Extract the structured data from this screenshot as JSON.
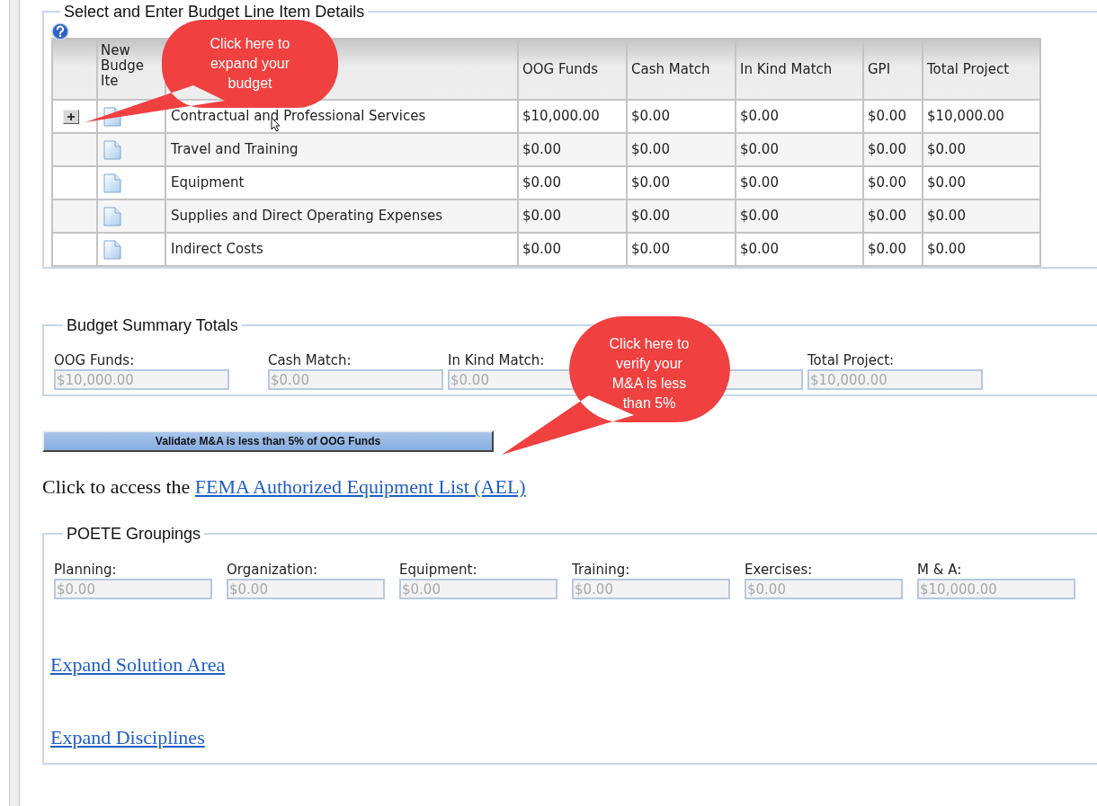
{
  "line_items": {
    "legend": "Select and Enter Budget Line Item Details",
    "new_item_header_lines": [
      "New",
      "Budge",
      "Ite"
    ],
    "columns": [
      "OOG Funds",
      "Cash Match",
      "In Kind Match",
      "GPI",
      "Total Project"
    ],
    "rows": [
      {
        "name": "Contractual and Professional Services",
        "expandable": true,
        "values": [
          "$10,000.00",
          "$0.00",
          "$0.00",
          "$0.00",
          "$10,000.00"
        ]
      },
      {
        "name": "Travel and Training",
        "expandable": false,
        "values": [
          "$0.00",
          "$0.00",
          "$0.00",
          "$0.00",
          "$0.00"
        ]
      },
      {
        "name": "Equipment",
        "expandable": false,
        "values": [
          "$0.00",
          "$0.00",
          "$0.00",
          "$0.00",
          "$0.00"
        ]
      },
      {
        "name": "Supplies and Direct Operating Expenses",
        "expandable": false,
        "values": [
          "$0.00",
          "$0.00",
          "$0.00",
          "$0.00",
          "$0.00"
        ]
      },
      {
        "name": "Indirect Costs",
        "expandable": false,
        "values": [
          "$0.00",
          "$0.00",
          "$0.00",
          "$0.00",
          "$0.00"
        ]
      }
    ]
  },
  "callouts": [
    {
      "text": "Click here to expand your budget"
    },
    {
      "text": "Click here to verify your M&A is less than 5%"
    }
  ],
  "summary": {
    "legend": "Budget Summary Totals",
    "fields": [
      {
        "label": "OOG Funds:",
        "value": "$10,000.00",
        "disabled": true
      },
      {
        "label": "Cash Match:",
        "value": "$0.00",
        "disabled": true
      },
      {
        "label": "In Kind Match:",
        "value": "$0.00",
        "disabled": true
      },
      {
        "disabled": true
      },
      {
        "label": "Total Project:",
        "value": "$10,000.00",
        "disabled": true
      }
    ]
  },
  "validate_button": "Validate M&A is less than 5% of OOG Funds",
  "access": {
    "text": "Click to access the",
    "link": "FEMA Authorized Equipment List (AEL)"
  },
  "poete": {
    "legend": "POETE Groupings",
    "fields": [
      {
        "label": "Planning:",
        "value": "$0.00",
        "disabled": true
      },
      {
        "label": "Organization:",
        "value": "$0.00",
        "disabled": true
      },
      {
        "label": "Equipment:",
        "value": "$0.00",
        "disabled": true
      },
      {
        "label": "Training:",
        "value": "$0.00",
        "disabled": true
      },
      {
        "label": "Exercises:",
        "value": "$0.00",
        "disabled": true
      },
      {
        "label": "M & A:",
        "value": "$10,000.00",
        "disabled": true
      }
    ],
    "links": [
      "Expand Solution Area",
      "Expand Disciplines"
    ]
  }
}
